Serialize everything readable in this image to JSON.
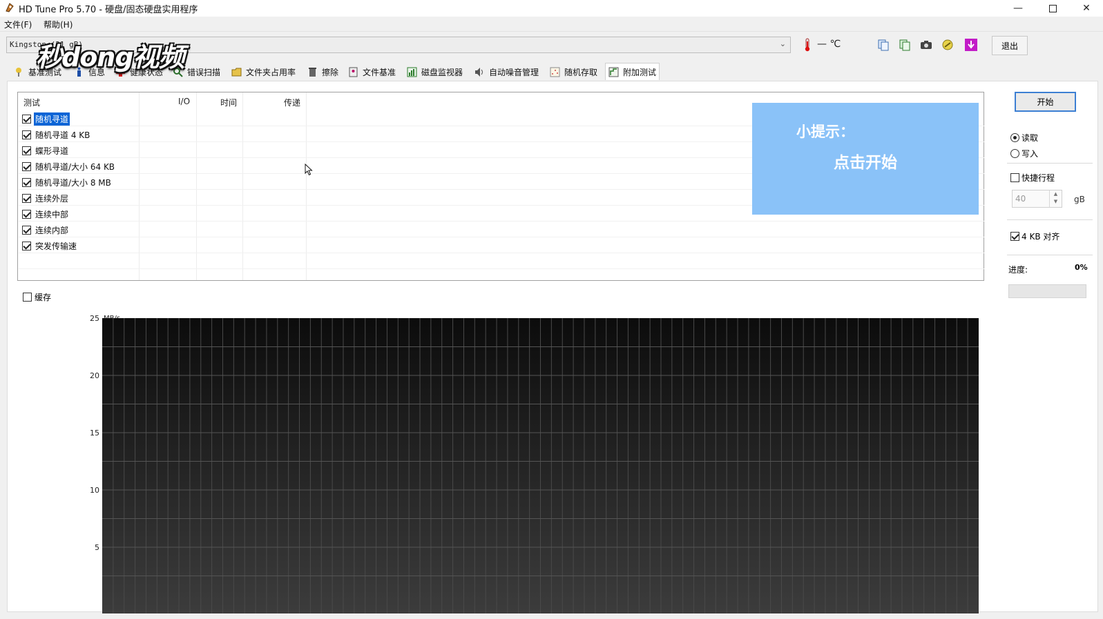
{
  "window": {
    "title": "HD Tune Pro 5.70 - 硬盘/固态硬盘实用程序",
    "controls": [
      "minimize-icon",
      "maximize-icon",
      "close-icon"
    ]
  },
  "menu": {
    "file": "文件(F)",
    "help": "帮助(H)"
  },
  "drive": {
    "selected": "Kingston  (31 gB)"
  },
  "temperature": "— ℃",
  "toolbar": {
    "icons": [
      "thermometer-icon",
      "copy-info-icon",
      "copy-screenshot-icon",
      "camera-icon",
      "options-icon",
      "save-icon"
    ],
    "exit_label": "退出"
  },
  "tabs": [
    {
      "label": "基准测试",
      "icon": "benchmark-icon"
    },
    {
      "label": "信息",
      "icon": "info-icon"
    },
    {
      "label": "健康状态",
      "icon": "health-icon"
    },
    {
      "label": "错误扫描",
      "icon": "error-scan-icon"
    },
    {
      "label": "文件夹占用率",
      "icon": "folder-usage-icon"
    },
    {
      "label": "擦除",
      "icon": "erase-icon"
    },
    {
      "label": "文件基准",
      "icon": "file-benchmark-icon"
    },
    {
      "label": "磁盘监视器",
      "icon": "disk-monitor-icon"
    },
    {
      "label": "自动噪音管理",
      "icon": "noise-icon"
    },
    {
      "label": "随机存取",
      "icon": "random-access-icon"
    },
    {
      "label": "附加测试",
      "icon": "extra-tests-icon",
      "active": true
    }
  ],
  "table": {
    "headers": {
      "test": "测试",
      "io": "I/O",
      "time": "时间",
      "transfer": "传递"
    },
    "rows": [
      {
        "label": "随机寻道",
        "checked": true,
        "selected": true
      },
      {
        "label": "随机寻道 4 KB",
        "checked": true
      },
      {
        "label": "蝶形寻道",
        "checked": true
      },
      {
        "label": "随机寻道/大小 64 KB",
        "checked": true
      },
      {
        "label": "随机寻道/大小 8 MB",
        "checked": true
      },
      {
        "label": "连续外层",
        "checked": true
      },
      {
        "label": "连续中部",
        "checked": true
      },
      {
        "label": "连续内部",
        "checked": true
      },
      {
        "label": "突发传输速",
        "checked": true
      }
    ]
  },
  "tip": {
    "title": "小提示：",
    "body": "点击开始"
  },
  "controls": {
    "start_label": "开始",
    "read_label": "读取",
    "write_label": "写入",
    "mode": "read",
    "quick_label": "快捷行程",
    "quick_checked": false,
    "quick_value": "40",
    "quick_unit": "gB",
    "align_label": "4 KB 对齐",
    "align_checked": true,
    "progress_label": "进度:",
    "progress_value": "0%",
    "progress_fraction": 0
  },
  "cache": {
    "label": "缓存",
    "checked": false
  },
  "watermark": "秒dong视频",
  "chart_data": {
    "type": "line",
    "ylabel": "MB/s",
    "ylim": [
      0,
      25
    ],
    "yticks": [
      5,
      10,
      15,
      20,
      25
    ],
    "grid": true,
    "series": []
  },
  "colors": {
    "tip_bg": "#8ac2f8",
    "selection": "#0a64d6",
    "start_border": "#3c7fd3",
    "chart_bg_top": "#0c0c0c",
    "chart_bg_bottom": "#3c3c3c"
  }
}
